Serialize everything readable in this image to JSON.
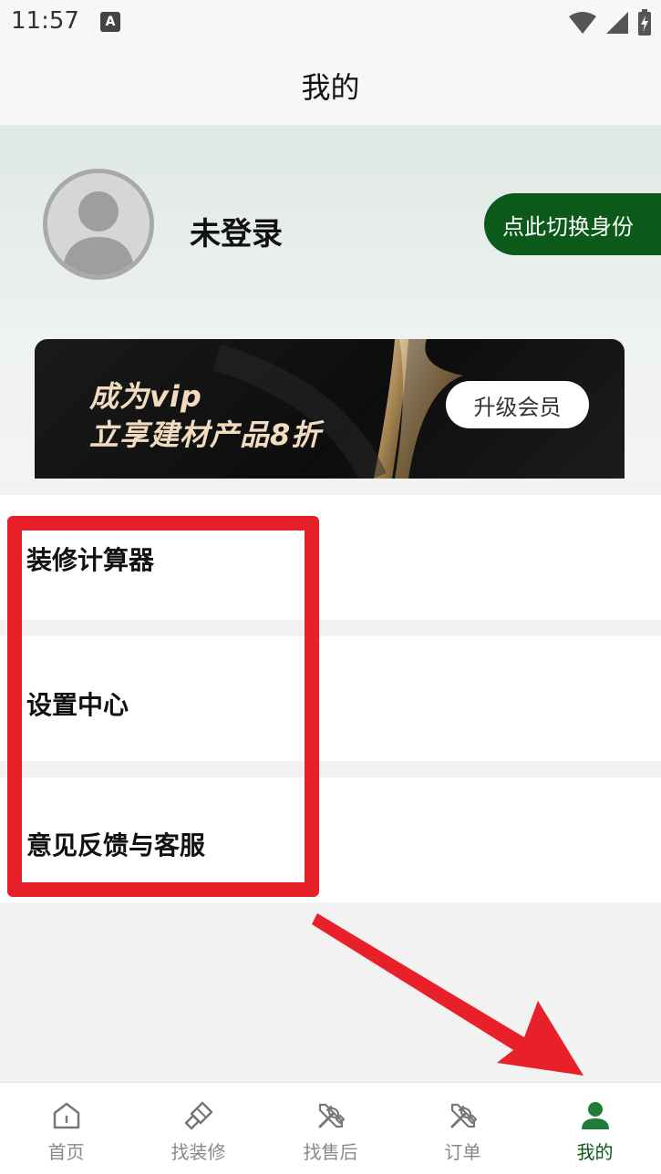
{
  "status_bar": {
    "time": "11:57",
    "a_badge": "A"
  },
  "header": {
    "title": "我的"
  },
  "profile": {
    "username": "未登录",
    "switch_identity_label": "点此切换身份"
  },
  "vip_banner": {
    "line1": "成为vip",
    "line2": "立享建材产品8折",
    "upgrade_label": "升级会员"
  },
  "menu": {
    "items": [
      {
        "label": "装修计算器"
      },
      {
        "label": "设置中心"
      },
      {
        "label": "意见反馈与客服"
      }
    ]
  },
  "bottom_nav": {
    "items": [
      {
        "label": "首页",
        "icon": "home-icon"
      },
      {
        "label": "找装修",
        "icon": "brush-icon"
      },
      {
        "label": "找售后",
        "icon": "tools-icon"
      },
      {
        "label": "订单",
        "icon": "tools-icon"
      },
      {
        "label": "我的",
        "icon": "user-icon",
        "active": true
      }
    ]
  },
  "colors": {
    "brand_green": "#0b5a1a",
    "annotation_red": "#e8202a"
  }
}
